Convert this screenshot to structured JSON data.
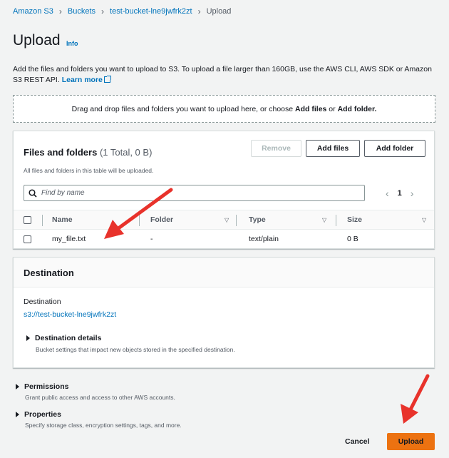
{
  "breadcrumb": {
    "items": [
      "Amazon S3",
      "Buckets",
      "test-bucket-lne9jwfrk2zt"
    ],
    "current": "Upload"
  },
  "page": {
    "title": "Upload",
    "info": "Info",
    "description": "Add the files and folders you want to upload to S3. To upload a file larger than 160GB, use the AWS CLI, AWS SDK or Amazon S3 REST API.",
    "learn_more": "Learn more"
  },
  "dropzone": {
    "text_prefix": "Drag and drop files and folders you want to upload here, or choose",
    "add_files": "Add files",
    "or": "or",
    "add_folder": "Add folder."
  },
  "files": {
    "title": "Files and folders",
    "count": "(1 Total, 0 B)",
    "subtitle": "All files and folders in this table will be uploaded.",
    "remove_label": "Remove",
    "add_files_label": "Add files",
    "add_folder_label": "Add folder",
    "search_placeholder": "Find by name",
    "page_number": "1",
    "columns": [
      "Name",
      "Folder",
      "Type",
      "Size"
    ],
    "rows": [
      {
        "name": "my_file.txt",
        "folder": "-",
        "type": "text/plain",
        "size": "0 B"
      }
    ]
  },
  "destination": {
    "title": "Destination",
    "label": "Destination",
    "link": "s3://test-bucket-lne9jwfrk2zt",
    "details_title": "Destination details",
    "details_sub": "Bucket settings that impact new objects stored in the specified destination."
  },
  "permissions": {
    "title": "Permissions",
    "sub": "Grant public access and access to other AWS accounts."
  },
  "properties": {
    "title": "Properties",
    "sub": "Specify storage class, encryption settings, tags, and more."
  },
  "footer": {
    "cancel_label": "Cancel",
    "upload_label": "Upload"
  },
  "colors": {
    "link": "#0073bb",
    "primary": "#ec7211",
    "annotation_arrow": "#e8322b"
  }
}
